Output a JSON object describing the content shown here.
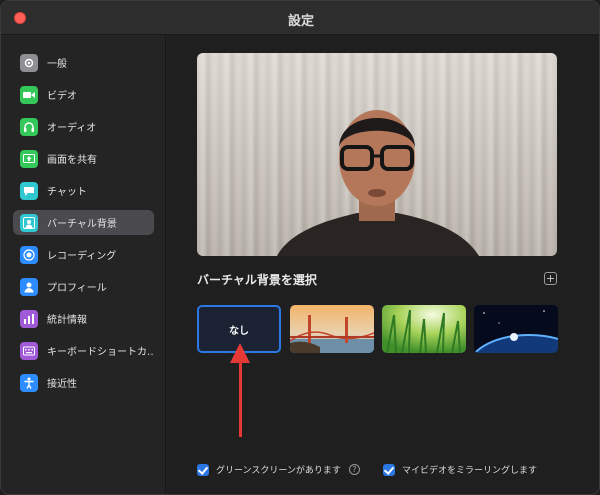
{
  "window": {
    "title": "設定"
  },
  "sidebar": {
    "items": [
      {
        "label": "一般",
        "icon": "gear-icon",
        "color": "#8e8e93"
      },
      {
        "label": "ビデオ",
        "icon": "video-icon",
        "color": "#34c759"
      },
      {
        "label": "オーディオ",
        "icon": "headphones-icon",
        "color": "#34c759"
      },
      {
        "label": "画面を共有",
        "icon": "share-screen-icon",
        "color": "#34c759"
      },
      {
        "label": "チャット",
        "icon": "chat-icon",
        "color": "#30c8d0"
      },
      {
        "label": "バーチャル背景",
        "icon": "virtual-background-icon",
        "color": "#30c8d0",
        "active": true
      },
      {
        "label": "レコーディング",
        "icon": "record-icon",
        "color": "#2d8cff"
      },
      {
        "label": "プロフィール",
        "icon": "profile-icon",
        "color": "#2d8cff"
      },
      {
        "label": "統計情報",
        "icon": "statistics-icon",
        "color": "#a05ad8"
      },
      {
        "label": "キーボードショートカ…",
        "icon": "keyboard-icon",
        "color": "#a05ad8"
      },
      {
        "label": "接近性",
        "icon": "accessibility-icon",
        "color": "#2d8cff"
      }
    ]
  },
  "main": {
    "section_title": "バーチャル背景を選択",
    "backgrounds": [
      {
        "label": "なし",
        "selected": true
      },
      {
        "label": "",
        "icon": "golden-gate-bridge-image"
      },
      {
        "label": "",
        "icon": "grass-image"
      },
      {
        "label": "",
        "icon": "earth-from-space-image"
      }
    ],
    "options": [
      {
        "label": "グリーンスクリーンがあります",
        "checked": true
      },
      {
        "label": "マイビデオをミラーリングします",
        "checked": true
      }
    ],
    "help_glyph": "?",
    "accent_color": "#2b78e4",
    "arrow_color": "#e53935"
  }
}
